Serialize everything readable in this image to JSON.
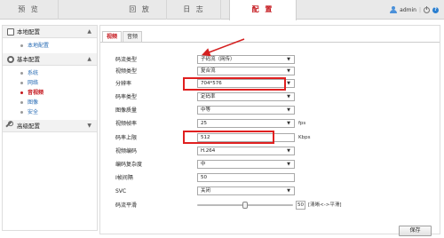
{
  "nav": {
    "tabs": [
      {
        "label": "预 览"
      },
      {
        "label": "回 放"
      },
      {
        "label": "日 志"
      },
      {
        "label": "配 置"
      }
    ],
    "active_index": 3,
    "user": "admin",
    "separator": "|"
  },
  "sidebar": {
    "groups": [
      {
        "label": "本地配置",
        "items": [
          {
            "label": "本地配置"
          }
        ]
      },
      {
        "label": "基本配置",
        "items": [
          {
            "label": "系统"
          },
          {
            "label": "网络"
          },
          {
            "label": "音视频"
          },
          {
            "label": "图像"
          },
          {
            "label": "安全"
          }
        ]
      },
      {
        "label": "高级配置",
        "items": []
      }
    ],
    "active_item": "音视频"
  },
  "subtabs": [
    {
      "label": "视频"
    },
    {
      "label": "音频"
    }
  ],
  "form": {
    "rows": [
      {
        "label": "码流类型",
        "value": "子码流（网传）",
        "type": "select"
      },
      {
        "label": "视频类型",
        "value": "复合流",
        "type": "select"
      },
      {
        "label": "分辨率",
        "value": "704*576",
        "type": "select"
      },
      {
        "label": "码率类型",
        "value": "定码率",
        "type": "select"
      },
      {
        "label": "图像质量",
        "value": "中等",
        "type": "select"
      },
      {
        "label": "视频帧率",
        "value": "25",
        "type": "select",
        "unit": "fps"
      },
      {
        "label": "码率上限",
        "value": "512",
        "type": "input",
        "unit": "Kbps"
      },
      {
        "label": "视频编码",
        "value": "H.264",
        "type": "select"
      },
      {
        "label": "编码复杂度",
        "value": "中",
        "type": "select"
      },
      {
        "label": "I帧间隔",
        "value": "50",
        "type": "input"
      },
      {
        "label": "SVC",
        "value": "关闭",
        "type": "select"
      }
    ],
    "smoothing": {
      "label": "码流平滑",
      "value": "50",
      "hint": "[清晰<->平滑]",
      "level": 0.5
    }
  },
  "save_label": "保存",
  "colors": {
    "accent": "#c4161c",
    "highlight": "#e02020",
    "link": "#2a6db5"
  }
}
